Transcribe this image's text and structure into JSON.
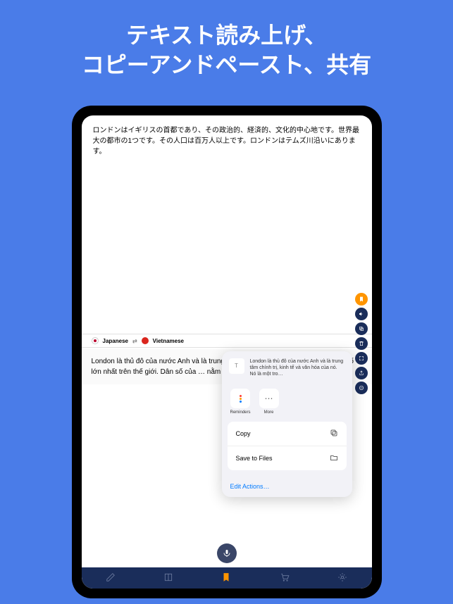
{
  "promo": {
    "line1": "テキスト読み上げ、",
    "line2": "コピーアンドペースト、共有"
  },
  "source_text": "ロンドンはイギリスの首都であり、その政治的、経済的、文化的中心地です。世界最大の都市の1つです。その人口は百万人以上です。ロンドンはテムズ川沿いにあります。",
  "lang": {
    "source": "Japanese",
    "target": "Vietnamese"
  },
  "translated_text": "London là thủ đô của nước Anh và là trung tâm chính trị, k… trọng những thành phố lớn nhất trên thế giới. Dân số của … nằm trên sông Thames.",
  "share": {
    "preview_text": "London là thủ đô của nước Anh và là trung tâm chính trị, kinh tế và văn hóa của nó. Nó là một tro…",
    "apps": {
      "reminders": "Reminders",
      "more": "More"
    },
    "actions": {
      "copy": "Copy",
      "save_files": "Save to Files"
    },
    "edit": "Edit Actions…"
  }
}
